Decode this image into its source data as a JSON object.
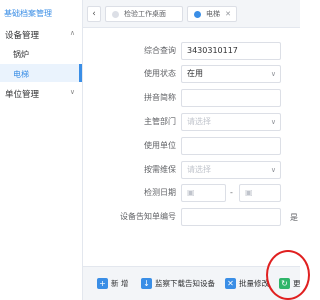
{
  "sidebar": {
    "section_title": "基础档案管理",
    "groups": [
      {
        "label": "设备管理",
        "expanded": true,
        "items": [
          {
            "label": "锅炉"
          },
          {
            "label": "电梯",
            "active": true
          }
        ]
      },
      {
        "label": "单位管理",
        "expanded": false
      }
    ]
  },
  "tabs": {
    "back_label": "‹",
    "items": [
      {
        "label": "检验工作桌面"
      },
      {
        "label": "电梯",
        "active": true
      }
    ]
  },
  "form": {
    "fields": [
      {
        "label": "综合查询",
        "value": "3430310117"
      },
      {
        "label": "使用状态",
        "value": "在用"
      },
      {
        "label": "拼音简称",
        "value": ""
      },
      {
        "label": "主管部门",
        "placeholder": "请选择"
      },
      {
        "label": "使用单位",
        "value": ""
      },
      {
        "label": "按需维保",
        "placeholder": "请选择"
      },
      {
        "label": "检测日期",
        "separator": "-"
      },
      {
        "label": "设备告知单编号",
        "value": ""
      }
    ],
    "truncated_label": "是"
  },
  "toolbar": {
    "buttons": [
      {
        "label": "新 增",
        "icon": "plus-icon",
        "color": "#3a8ee6"
      },
      {
        "label": "监察下载告知设备",
        "icon": "download-icon",
        "color": "#3a8ee6"
      },
      {
        "label": "批量修改",
        "icon": "tools-icon",
        "color": "#3a8ee6"
      },
      {
        "label": "更",
        "icon": "update-icon",
        "color": "#2fb56a"
      }
    ]
  },
  "colors": {
    "accent": "#3a8ee6",
    "highlight": "#e02020"
  }
}
